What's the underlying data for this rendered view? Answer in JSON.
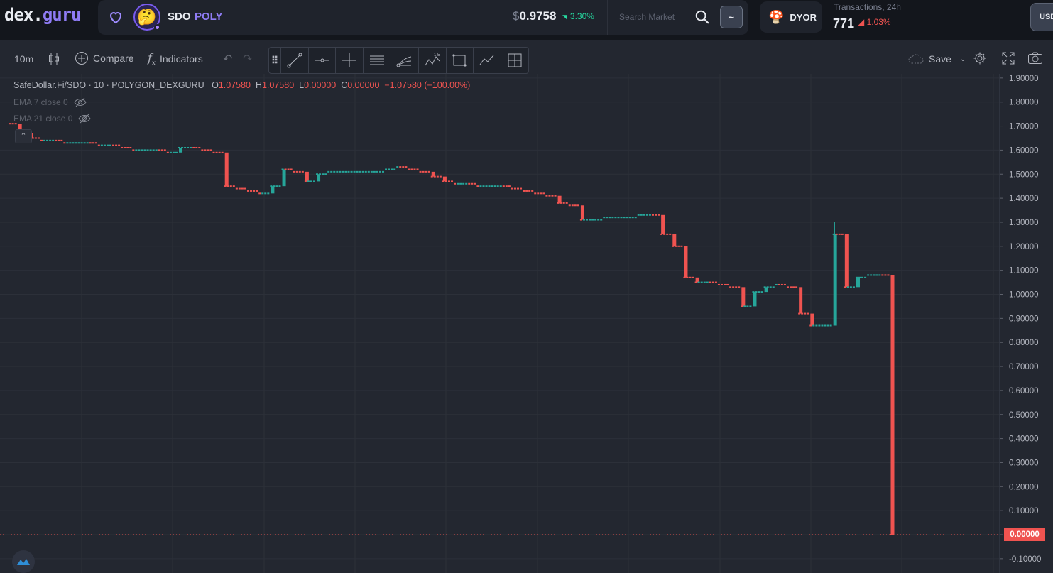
{
  "header": {
    "logo_main": "dex",
    "logo_dot": ".",
    "logo_accent": "guru",
    "token_symbol": "SDO",
    "token_network": "POLY",
    "price_currency": "$",
    "price_value": "0.9758",
    "price_change": "3.30%",
    "search_placeholder": "Search Market",
    "tilde_label": "~",
    "dyor_label": "DYOR",
    "tx_label": "Transactions, 24h",
    "tx_count": "771",
    "tx_change": "1.03%",
    "currency_label": "USD"
  },
  "toolbar": {
    "interval": "10m",
    "compare": "Compare",
    "indicators": "Indicators",
    "save": "Save"
  },
  "legend": {
    "pair": "SafeDollar.Fi/SDO",
    "interval": "10",
    "source": "POLYGON_DEXGURU",
    "o_key": "O",
    "o_val": "1.07580",
    "h_key": "H",
    "h_val": "1.07580",
    "l_key": "L",
    "l_val": "0.00000",
    "c_key": "C",
    "c_val": "0.00000",
    "change": "−1.07580 (−100.00%)",
    "ema1": "EMA 7 close 0",
    "ema2": "EMA 21 close 0"
  },
  "chart_data": {
    "type": "candlestick",
    "y_axis_labels": [
      "1.90000",
      "1.80000",
      "1.70000",
      "1.60000",
      "1.50000",
      "1.40000",
      "1.30000",
      "1.20000",
      "1.10000",
      "1.00000",
      "0.90000",
      "0.80000",
      "0.70000",
      "0.60000",
      "0.50000",
      "0.40000",
      "0.30000",
      "0.20000",
      "0.10000",
      "0.00000",
      "-0.10000"
    ],
    "ylim": [
      -0.12,
      1.93
    ],
    "last_price_label": "0.00000",
    "colors": {
      "up": "#26a69a",
      "down": "#ef5350",
      "grid": "#2c3039",
      "background": "#232730"
    },
    "price_path": [
      [
        0,
        1.71
      ],
      [
        1,
        1.67
      ],
      [
        2,
        1.65
      ],
      [
        3,
        1.64
      ],
      [
        4,
        1.64
      ],
      [
        5,
        1.63
      ],
      [
        6,
        1.63
      ],
      [
        7,
        1.63
      ],
      [
        8,
        1.62
      ],
      [
        9,
        1.62
      ],
      [
        10,
        1.61
      ],
      [
        11,
        1.6
      ],
      [
        12,
        1.6
      ],
      [
        13,
        1.6
      ],
      [
        14,
        1.59
      ],
      [
        15,
        1.61
      ],
      [
        16,
        1.61
      ],
      [
        17,
        1.6
      ],
      [
        18,
        1.59
      ],
      [
        19,
        1.45
      ],
      [
        20,
        1.44
      ],
      [
        21,
        1.43
      ],
      [
        22,
        1.42
      ],
      [
        23,
        1.45
      ],
      [
        24,
        1.52
      ],
      [
        25,
        1.51
      ],
      [
        26,
        1.47
      ],
      [
        27,
        1.5
      ],
      [
        28,
        1.51
      ],
      [
        29,
        1.51
      ],
      [
        30,
        1.51
      ],
      [
        31,
        1.51
      ],
      [
        32,
        1.51
      ],
      [
        33,
        1.52
      ],
      [
        34,
        1.53
      ],
      [
        35,
        1.52
      ],
      [
        36,
        1.51
      ],
      [
        37,
        1.49
      ],
      [
        38,
        1.47
      ],
      [
        39,
        1.46
      ],
      [
        40,
        1.46
      ],
      [
        41,
        1.45
      ],
      [
        42,
        1.45
      ],
      [
        43,
        1.45
      ],
      [
        44,
        1.44
      ],
      [
        45,
        1.43
      ],
      [
        46,
        1.42
      ],
      [
        47,
        1.41
      ],
      [
        48,
        1.38
      ],
      [
        49,
        1.37
      ],
      [
        50,
        1.31
      ],
      [
        51,
        1.31
      ],
      [
        52,
        1.32
      ],
      [
        53,
        1.32
      ],
      [
        54,
        1.32
      ],
      [
        55,
        1.33
      ],
      [
        56,
        1.33
      ],
      [
        57,
        1.25
      ],
      [
        58,
        1.2
      ],
      [
        59,
        1.07
      ],
      [
        60,
        1.05
      ],
      [
        61,
        1.05
      ],
      [
        62,
        1.04
      ],
      [
        63,
        1.03
      ],
      [
        64,
        0.95
      ],
      [
        65,
        1.01
      ],
      [
        66,
        1.03
      ],
      [
        67,
        1.04
      ],
      [
        68,
        1.03
      ],
      [
        69,
        0.92
      ],
      [
        70,
        0.87
      ],
      [
        71,
        0.87
      ],
      [
        72,
        1.25
      ],
      [
        73,
        1.03
      ],
      [
        74,
        1.07
      ],
      [
        75,
        1.08
      ],
      [
        76,
        1.08
      ],
      [
        77,
        0.0
      ]
    ]
  }
}
